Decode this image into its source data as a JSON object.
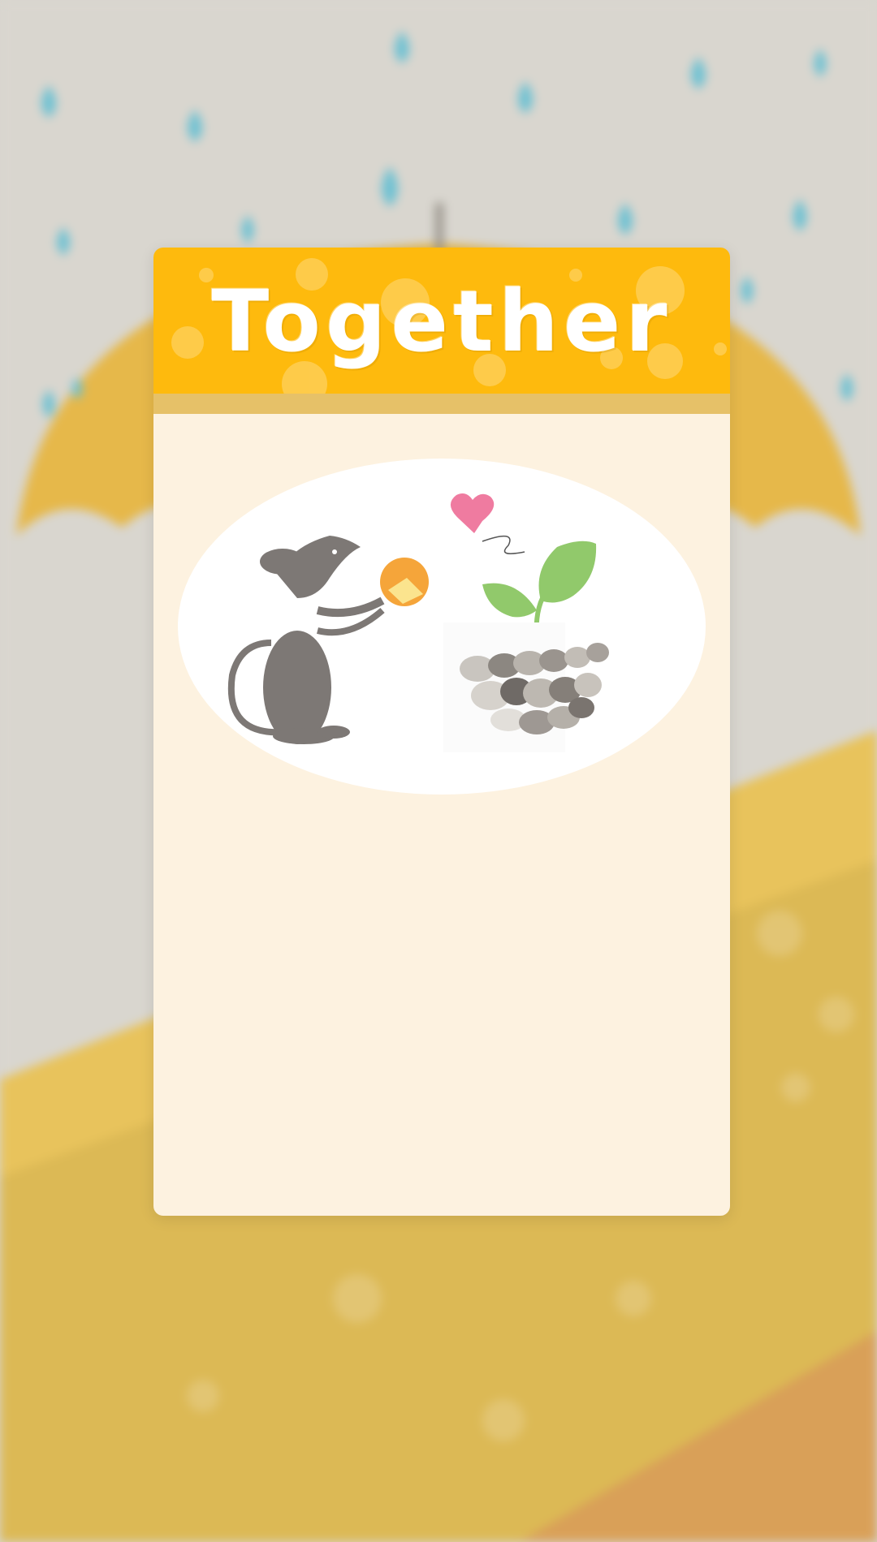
{
  "screen": {
    "title": "Together",
    "illustration_name": "mouse-with-cheese-and-sprout"
  },
  "colors": {
    "header_bg": "#feba0d",
    "panel_bg": "#fdf2e0",
    "ellipse_bg": "#ffffff",
    "background": "#d9d6cf",
    "raindrop": "#6fc1d2",
    "umbrella": "#e6b84a",
    "mouse": "#7d7875",
    "sprout": "#91c96b",
    "heart": "#ef7ba0",
    "cheese": "#f5a53a"
  },
  "icons": {
    "mouse": "mouse-icon",
    "cheese": "cheese-icon",
    "heart": "heart-icon",
    "sprout": "sprout-icon",
    "stones": "stones-icon"
  }
}
